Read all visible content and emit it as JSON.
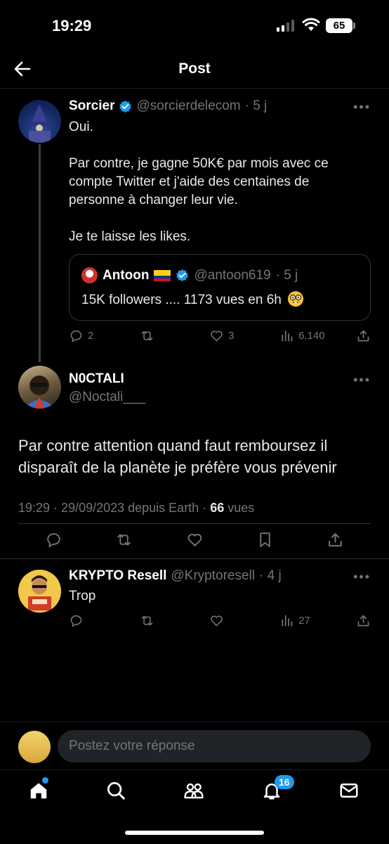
{
  "status_bar": {
    "time": "19:29",
    "battery": "65"
  },
  "header": {
    "title": "Post"
  },
  "parent_tweet": {
    "name": "Sorcier",
    "handle": "@sorcierdelecom",
    "age": "· 5 j",
    "more": "•••",
    "text_lines": [
      "Oui.",
      "Par contre, je gagne 50K€ par mois avec ce",
      "compte Twitter et j'aide des centaines de",
      "personne à changer leur vie.",
      "Je te laisse les likes."
    ],
    "quote": {
      "name": "Antoon",
      "handle": "@antoon619",
      "age": "· 5 j",
      "text": "15K followers .... 1173 vues en 6h"
    },
    "replies": "2",
    "retweets": "",
    "likes": "3",
    "views": "6.140"
  },
  "main_tweet": {
    "name": "N0CTALI",
    "handle": "@Noctali___",
    "more": "•••",
    "text": "Par contre attention quand faut remboursez il disparaît de la planète je préfère vous prévenir",
    "meta_time": "19:29 · 29/09/2023 depuis Earth ·",
    "meta_views": "66",
    "meta_views_label": "vues"
  },
  "reply_tweet": {
    "name": "KRYPTO Resell",
    "handle": "@Kryptoresell",
    "age": "· 4 j",
    "more": "•••",
    "text": "Trop",
    "views": "27"
  },
  "reply_bar": {
    "placeholder": "Postez votre réponse"
  },
  "tabbar": {
    "notifications_badge": "16"
  },
  "colors": {
    "background": "#000000",
    "accent": "#1d9bf0",
    "muted": "#71767b",
    "text": "#e7e9ea"
  },
  "icons": [
    "back-arrow-icon",
    "verified-icon",
    "reply-icon",
    "retweet-icon",
    "like-icon",
    "views-icon",
    "share-icon",
    "bookmark-icon",
    "home-icon",
    "search-icon",
    "communities-icon",
    "bell-icon",
    "mail-icon"
  ]
}
